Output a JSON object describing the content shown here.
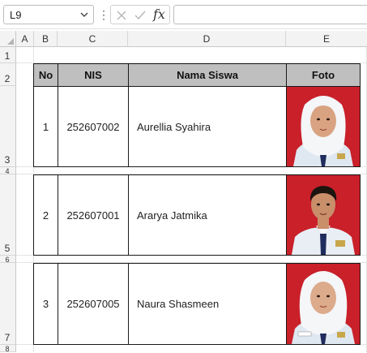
{
  "name_box": "L9",
  "formula_icons": [
    "cancel-icon",
    "enter-icon",
    "fx-icon"
  ],
  "fx_label": "fx",
  "formula_value": "",
  "columns": [
    "A",
    "B",
    "C",
    "D",
    "E"
  ],
  "rows": [
    "1",
    "2",
    "3",
    "4",
    "5",
    "6",
    "7",
    "8"
  ],
  "table": {
    "headers": {
      "no": "No",
      "nis": "NIS",
      "nama": "Nama Siswa",
      "foto": "Foto"
    },
    "students": [
      {
        "no": "1",
        "nis": "252607002",
        "nama": "Aurellia Syahira",
        "photo": "student-photo-girl-hijab"
      },
      {
        "no": "2",
        "nis": "252607001",
        "nama": "Ararya Jatmika",
        "photo": "student-photo-boy"
      },
      {
        "no": "3",
        "nis": "252607005",
        "nama": "Naura Shasmeen",
        "photo": "student-photo-girl-hijab"
      }
    ]
  },
  "colors": {
    "photo_background": "#c9202a",
    "header_fill": "#bfbfbf",
    "uniform_tie": "#1f2c5c"
  }
}
